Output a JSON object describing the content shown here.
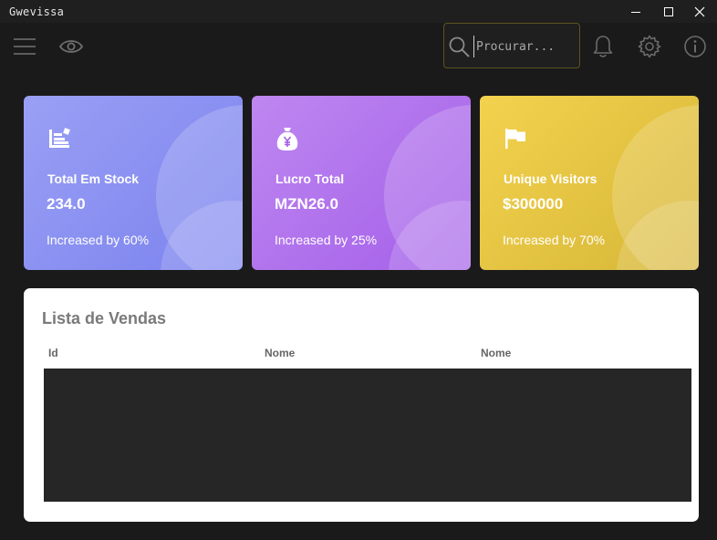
{
  "window": {
    "title": "Gwevissa"
  },
  "toolbar": {
    "menu_icon": "hamburger-menu-icon",
    "view_icon": "eye-icon",
    "search": {
      "placeholder": "Procurar...",
      "value": ""
    },
    "notification_icon": "bell-icon",
    "settings_icon": "gear-icon",
    "info_icon": "info-icon"
  },
  "cards": [
    {
      "icon": "inventory-icon",
      "label": "Total Em Stock",
      "value": "234.0",
      "footer": "Increased by 60%",
      "color_start": "#9aa0f4",
      "color_end": "#7b82ee"
    },
    {
      "icon": "money-bag-yen-icon",
      "label": "Lucro Total",
      "value": "MZN26.0",
      "footer": "Increased by 25%",
      "color_start": "#be87f0",
      "color_end": "#a45fe9"
    },
    {
      "icon": "flag-icon",
      "label": "Unique Visitors",
      "value": "$300000",
      "footer": "Increased by 70%",
      "color_start": "#f3d24e",
      "color_end": "#d6b637"
    }
  ],
  "sales": {
    "title": "Lista de Vendas",
    "columns": [
      "Id",
      "Nome",
      "Nome"
    ],
    "rows": []
  },
  "colors": {
    "background": "#1a1a1a",
    "search_border": "#5c5320",
    "table_body": "#262626"
  }
}
